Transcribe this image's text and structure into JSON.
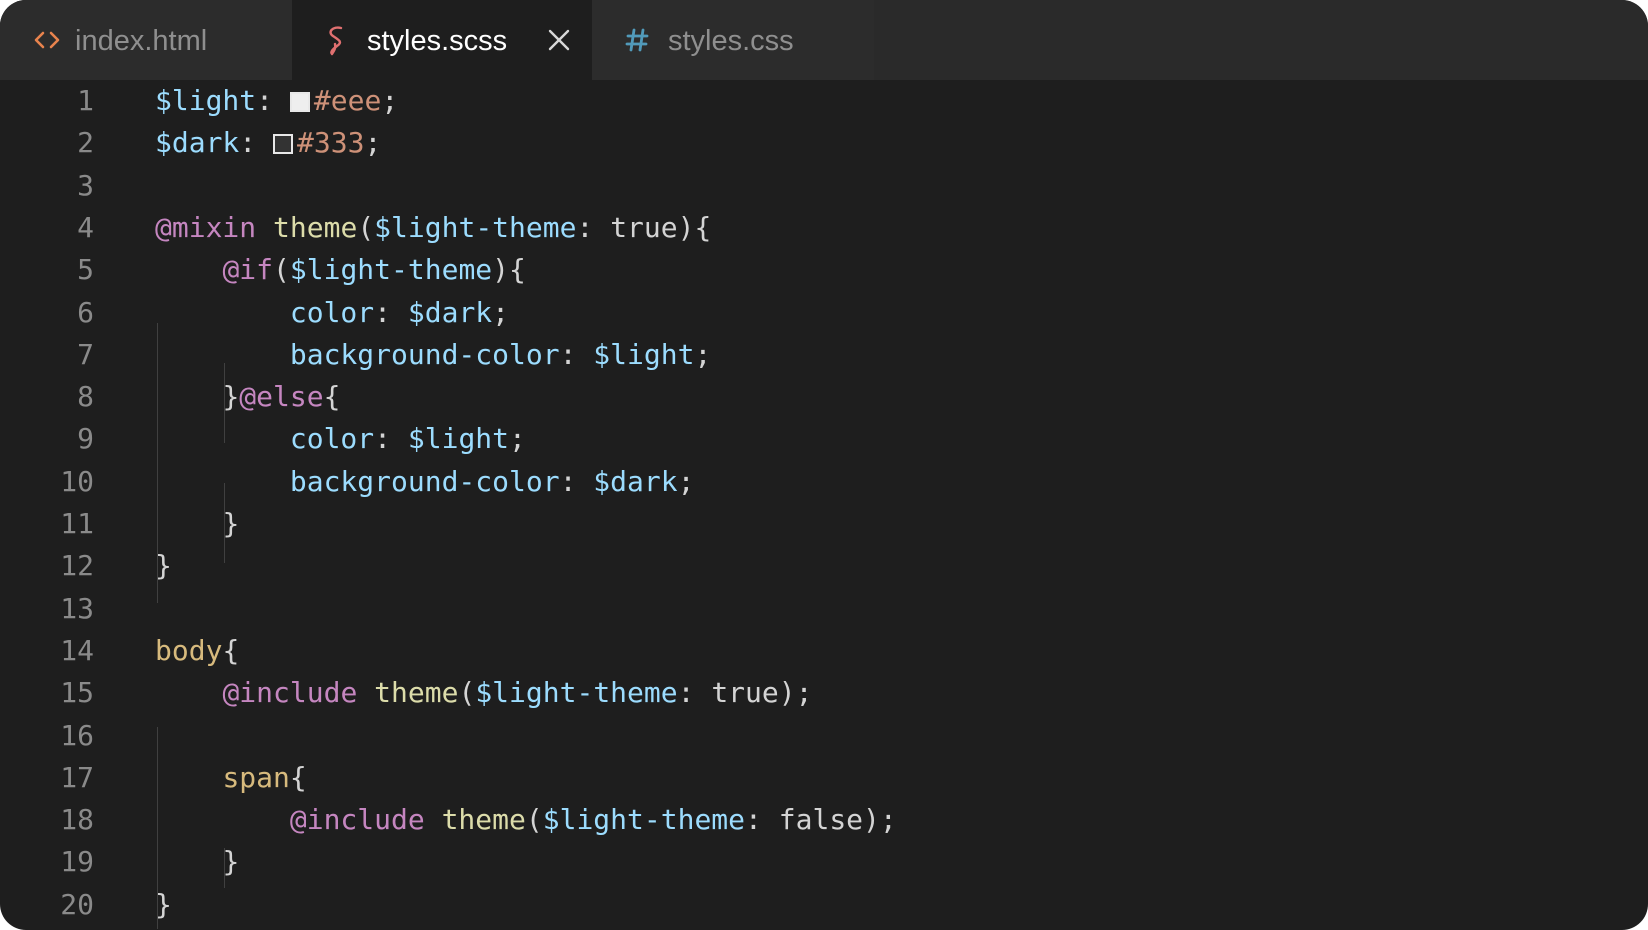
{
  "tabs": [
    {
      "label": "index.html",
      "icon": "code-brackets-icon",
      "icon_color": "#e8834d",
      "active": false
    },
    {
      "label": "styles.scss",
      "icon": "sass-icon",
      "icon_color": "#e07070",
      "active": true,
      "close_icon": "close-icon"
    },
    {
      "label": "styles.css",
      "icon": "hash-icon",
      "icon_color": "#519aba",
      "active": false
    }
  ],
  "colors": {
    "editor_background": "#1e1e1e",
    "tabbar_background": "#2a2a2a",
    "variable": "#9cdcfe",
    "keyword": "#c586c0",
    "function": "#dcdcaa",
    "selector": "#d7ba7d",
    "hex_value": "#ce9178",
    "line_number": "#8a8a8a"
  },
  "lines": [
    {
      "n": "1",
      "tokens": [
        [
          "var",
          "$light"
        ],
        [
          "pun",
          ": "
        ],
        [
          "swatch-eee",
          ""
        ],
        [
          "str",
          "#eee"
        ],
        [
          "pun",
          ";"
        ]
      ]
    },
    {
      "n": "2",
      "tokens": [
        [
          "var",
          "$dark"
        ],
        [
          "pun",
          ": "
        ],
        [
          "swatch-333",
          ""
        ],
        [
          "str",
          "#333"
        ],
        [
          "pun",
          ";"
        ]
      ]
    },
    {
      "n": "3",
      "tokens": []
    },
    {
      "n": "4",
      "tokens": [
        [
          "kw",
          "@mixin"
        ],
        [
          "txt",
          " "
        ],
        [
          "fn",
          "theme"
        ],
        [
          "pun",
          "("
        ],
        [
          "var",
          "$light-theme"
        ],
        [
          "pun",
          ": "
        ],
        [
          "txt",
          "true"
        ],
        [
          "pun",
          ")"
        ],
        [
          "brk",
          "{"
        ]
      ]
    },
    {
      "n": "5",
      "tokens": [
        [
          "txt",
          "    "
        ],
        [
          "kw",
          "@if"
        ],
        [
          "pun",
          "("
        ],
        [
          "var",
          "$light-theme"
        ],
        [
          "pun",
          ")"
        ],
        [
          "brk",
          "{"
        ]
      ]
    },
    {
      "n": "6",
      "tokens": [
        [
          "txt",
          "        "
        ],
        [
          "prop",
          "color"
        ],
        [
          "pun",
          ": "
        ],
        [
          "var",
          "$dark"
        ],
        [
          "pun",
          ";"
        ]
      ]
    },
    {
      "n": "7",
      "tokens": [
        [
          "txt",
          "        "
        ],
        [
          "prop",
          "background-color"
        ],
        [
          "pun",
          ": "
        ],
        [
          "var",
          "$light"
        ],
        [
          "pun",
          ";"
        ]
      ]
    },
    {
      "n": "8",
      "tokens": [
        [
          "txt",
          "    "
        ],
        [
          "brk",
          "}"
        ],
        [
          "kw",
          "@else"
        ],
        [
          "brk",
          "{"
        ]
      ]
    },
    {
      "n": "9",
      "tokens": [
        [
          "txt",
          "        "
        ],
        [
          "prop",
          "color"
        ],
        [
          "pun",
          ": "
        ],
        [
          "var",
          "$light"
        ],
        [
          "pun",
          ";"
        ]
      ]
    },
    {
      "n": "10",
      "tokens": [
        [
          "txt",
          "        "
        ],
        [
          "prop",
          "background-color"
        ],
        [
          "pun",
          ": "
        ],
        [
          "var",
          "$dark"
        ],
        [
          "pun",
          ";"
        ]
      ]
    },
    {
      "n": "11",
      "tokens": [
        [
          "txt",
          "    "
        ],
        [
          "brk",
          "}"
        ]
      ]
    },
    {
      "n": "12",
      "tokens": [
        [
          "brk",
          "}"
        ]
      ]
    },
    {
      "n": "13",
      "tokens": []
    },
    {
      "n": "14",
      "tokens": [
        [
          "sel",
          "body"
        ],
        [
          "brk",
          "{"
        ]
      ]
    },
    {
      "n": "15",
      "tokens": [
        [
          "txt",
          "    "
        ],
        [
          "kw",
          "@include"
        ],
        [
          "txt",
          " "
        ],
        [
          "fn",
          "theme"
        ],
        [
          "pun",
          "("
        ],
        [
          "var",
          "$light-theme"
        ],
        [
          "pun",
          ": "
        ],
        [
          "txt",
          "true"
        ],
        [
          "pun",
          ");"
        ]
      ]
    },
    {
      "n": "16",
      "tokens": []
    },
    {
      "n": "17",
      "tokens": [
        [
          "txt",
          "    "
        ],
        [
          "sel",
          "span"
        ],
        [
          "brk",
          "{"
        ]
      ]
    },
    {
      "n": "18",
      "tokens": [
        [
          "txt",
          "        "
        ],
        [
          "kw",
          "@include"
        ],
        [
          "txt",
          " "
        ],
        [
          "fn",
          "theme"
        ],
        [
          "pun",
          "("
        ],
        [
          "var",
          "$light-theme"
        ],
        [
          "pun",
          ": "
        ],
        [
          "txt",
          "false"
        ],
        [
          "pun",
          ");"
        ]
      ]
    },
    {
      "n": "19",
      "tokens": [
        [
          "txt",
          "    "
        ],
        [
          "brk",
          "}"
        ]
      ]
    },
    {
      "n": "20",
      "tokens": [
        [
          "brk",
          "}"
        ]
      ]
    }
  ]
}
